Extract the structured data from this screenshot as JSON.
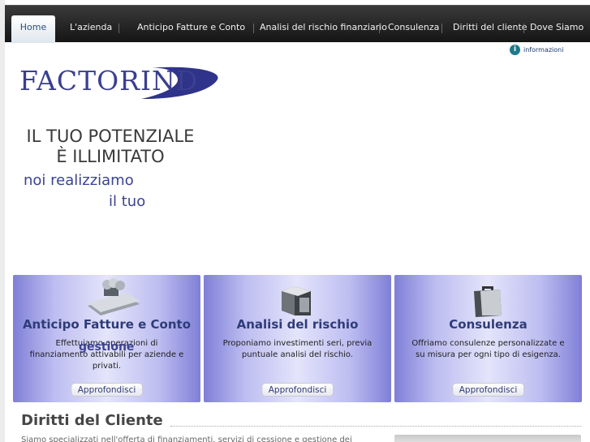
{
  "nav": {
    "items": [
      {
        "label": "Home",
        "active": true
      },
      {
        "label": "L'azienda"
      },
      {
        "label": "Anticipo Fatture e Conto"
      },
      {
        "label": "Analisi del rischio finanziario"
      },
      {
        "label": "Consulenza"
      },
      {
        "label": "Diritti del cliente"
      },
      {
        "label": "Dove Siamo"
      }
    ]
  },
  "header": {
    "info_label": "informazioni",
    "info_icon": "info-icon",
    "logo_text": "FACTORIND"
  },
  "slogan": {
    "line1": "IL TUO POTENZIALE",
    "line2": "È ILLIMITATO",
    "line3": "noi realizziamo",
    "line4": "il tuo",
    "line5": "gestione"
  },
  "boxes": [
    {
      "icon": "calculator-icon",
      "title": "Anticipo Fatture e Conto",
      "description": "Effettuiamo operazioni di finanziamento attivabili per aziende e privati.",
      "button": "Approfondisci"
    },
    {
      "icon": "cubes-chart-icon",
      "title": "Analisi del rischio",
      "description": "Proponiamo investimenti seri, previa puntuale analisi del rischio.",
      "button": "Approfondisci"
    },
    {
      "icon": "briefcase-icon",
      "title": "Consulenza",
      "description": "Offriamo consulenze personalizzate e su misura per ogni tipo di esigenza.",
      "button": "Approfondisci"
    }
  ],
  "rights": {
    "title": "Diritti del Cliente",
    "body": "Siamo specializzati nell'offerta di finanziamenti, servizi di cessione e gestione dei"
  },
  "colors": {
    "nav_bg": "#1c1c1c",
    "brand": "#3a3f8f",
    "box_edge": "#7f7fd8",
    "box_center": "#e4e4fb"
  }
}
